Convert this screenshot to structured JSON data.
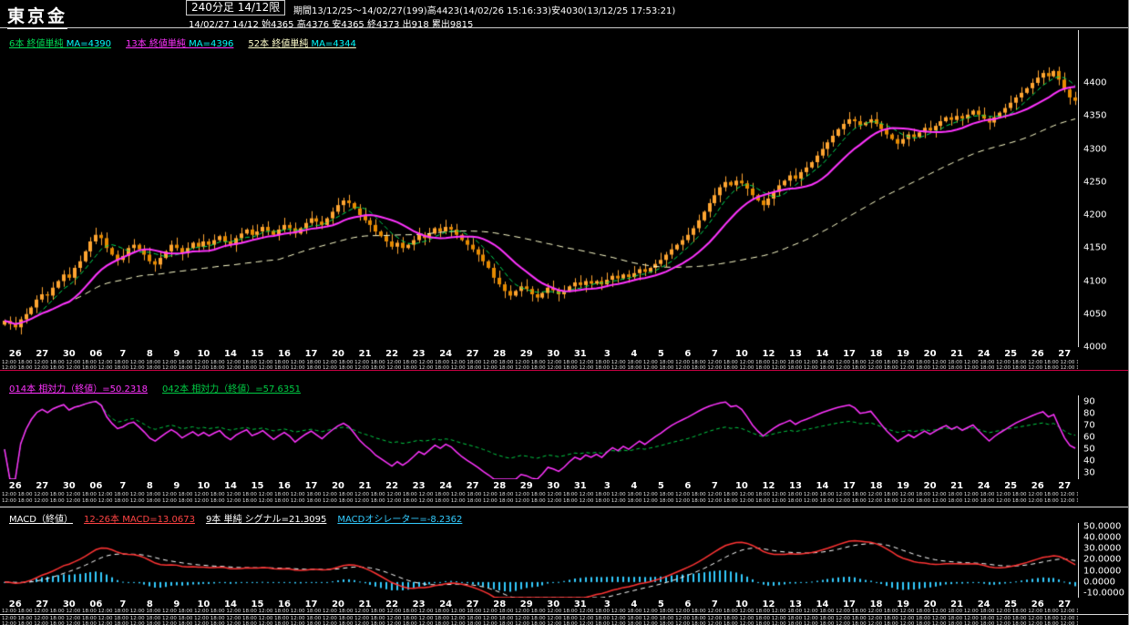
{
  "header": {
    "title": "東京金",
    "timeframe_box": "240分足 14/12限",
    "info_line1": "期間13/12/25～14/02/27(199)高4423(14/02/26 15:16:33)安4030(13/12/25 17:53:21)",
    "info_line2": "14/02/27 14/12 始4365 高4376 安4365 終4373 出918 累出9815"
  },
  "colors": {
    "background": "#000000",
    "text": "#ffffff",
    "candle": "#ffa531",
    "candle_down": "#e68a00",
    "ma6": "#00dd55",
    "ma13": "#ff33ff",
    "ma52": "#ffffcc",
    "rsi_fast": "#ff33ff",
    "rsi_slow": "#00cc44",
    "macd_line": "#ff3333",
    "signal_line": "#ffffff",
    "histogram": "#33ccff",
    "separator_red": "#cc0044",
    "value_highlight": "#00ffff"
  },
  "main_chart": {
    "legend": [
      {
        "label": "6本 終値単純 ",
        "value": "MA=4390",
        "color": "#00dd55"
      },
      {
        "label": "13本 終値単純 ",
        "value": "MA=4396",
        "color": "#ff33ff"
      },
      {
        "label": "52本 終値単純 ",
        "value": "MA=4344",
        "color": "#ffffcc"
      }
    ],
    "y_ticks": [
      "4400",
      "4350",
      "4300",
      "4250",
      "4200",
      "4150",
      "4100",
      "4050",
      "4000"
    ],
    "y_scale": [
      4000,
      4480
    ]
  },
  "rsi_panel": {
    "legend": [
      {
        "label": "014本 相対力（終値）=50.2318",
        "color": "#ff33ff"
      },
      {
        "label": "042本 相対力（終値）=57.6351",
        "color": "#00cc44"
      }
    ],
    "y_ticks": [
      "90",
      "80",
      "70",
      "60",
      "50",
      "40",
      "30"
    ],
    "y_scale": [
      25,
      95
    ]
  },
  "macd_panel": {
    "legend": [
      {
        "label": "MACD（終値）",
        "color": "#ffffff"
      },
      {
        "label": "12-26本 MACD=13.0673",
        "color": "#ff4444"
      },
      {
        "label": "9本 単純 シグナル=21.3095",
        "color": "#ffffff"
      },
      {
        "label": "MACDオシレーター=-8.2362",
        "color": "#33ccff"
      }
    ],
    "y_ticks": [
      "50.0000",
      "40.0000",
      "30.0000",
      "20.0000",
      "10.0000",
      "0.0000",
      "-10.0000"
    ],
    "y_scale": [
      -14,
      53
    ]
  },
  "axis": {
    "day_labels": [
      "26",
      "27",
      "30",
      "06",
      "7",
      "8",
      "9",
      "10",
      "14",
      "15",
      "16",
      "17",
      "20",
      "21",
      "22",
      "23",
      "24",
      "27",
      "28",
      "29",
      "30",
      "31",
      "3",
      "4",
      "5",
      "6",
      "7",
      "10",
      "12",
      "13",
      "14",
      "17",
      "18",
      "19",
      "20",
      "21",
      "24",
      "25",
      "26",
      "27"
    ],
    "time_pattern": "12:00 18:00 "
  },
  "chart_data": {
    "type": "candlestick",
    "title": "東京金 240分足 14/12限",
    "x_axis": "2013/12/26 - 2014/02/27, 240分足 (199 bars)",
    "y_range": [
      4000,
      4450
    ],
    "session_high": 4423,
    "session_low": 4030,
    "last_bar": {
      "open": 4365,
      "high": 4376,
      "low": 4365,
      "close": 4373,
      "volume": 918,
      "open_interest": 9815
    },
    "closes": [
      4040,
      4035,
      4030,
      4042,
      4050,
      4060,
      4072,
      4080,
      4078,
      4090,
      4100,
      4110,
      4105,
      4120,
      4130,
      4145,
      4160,
      4170,
      4165,
      4150,
      4140,
      4132,
      4138,
      4150,
      4155,
      4148,
      4140,
      4130,
      4125,
      4135,
      4145,
      4155,
      4150,
      4142,
      4150,
      4158,
      4152,
      4160,
      4155,
      4162,
      4168,
      4160,
      4155,
      4165,
      4172,
      4178,
      4170,
      4175,
      4182,
      4176,
      4170,
      4178,
      4185,
      4180,
      4172,
      4180,
      4188,
      4195,
      4190,
      4185,
      4195,
      4205,
      4215,
      4222,
      4218,
      4210,
      4200,
      4192,
      4185,
      4175,
      4168,
      4160,
      4152,
      4158,
      4150,
      4155,
      4162,
      4170,
      4165,
      4172,
      4180,
      4175,
      4182,
      4178,
      4170,
      4162,
      4155,
      4148,
      4140,
      4130,
      4120,
      4105,
      4095,
      4085,
      4078,
      4085,
      4092,
      4088,
      4080,
      4075,
      4082,
      4090,
      4086,
      4080,
      4085,
      4092,
      4098,
      4094,
      4100,
      4096,
      4100,
      4095,
      4102,
      4108,
      4104,
      4110,
      4106,
      4112,
      4118,
      4114,
      4120,
      4126,
      4132,
      4140,
      4148,
      4155,
      4162,
      4170,
      4180,
      4192,
      4205,
      4218,
      4230,
      4242,
      4250,
      4245,
      4252,
      4248,
      4240,
      4230,
      4222,
      4215,
      4225,
      4235,
      4245,
      4252,
      4260,
      4255,
      4265,
      4272,
      4280,
      4290,
      4300,
      4310,
      4320,
      4330,
      4338,
      4345,
      4342,
      4336,
      4340,
      4345,
      4338,
      4330,
      4322,
      4315,
      4308,
      4315,
      4322,
      4318,
      4325,
      4332,
      4328,
      4335,
      4342,
      4348,
      4344,
      4350,
      4346,
      4352,
      4358,
      4352,
      4346,
      4340,
      4348,
      4355,
      4362,
      4370,
      4378,
      4385,
      4392,
      4400,
      4408,
      4415,
      4410,
      4418,
      4405,
      4390,
      4378,
      4373
    ],
    "moving_averages": [
      {
        "period": 6,
        "type": "終値単純",
        "last": 4390
      },
      {
        "period": 13,
        "type": "終値単純",
        "last": 4396
      },
      {
        "period": 52,
        "type": "終値単純",
        "last": 4344
      }
    ],
    "rsi": [
      {
        "period": 14,
        "label": "相対力（終値）",
        "last": 50.2318
      },
      {
        "period": 42,
        "label": "相対力（終値）",
        "last": 57.6351
      }
    ],
    "macd": {
      "fast": 12,
      "slow": 26,
      "signal_period": 9,
      "last": 13.0673,
      "signal_last": 21.3095,
      "oscillator_last": -8.2362
    }
  }
}
